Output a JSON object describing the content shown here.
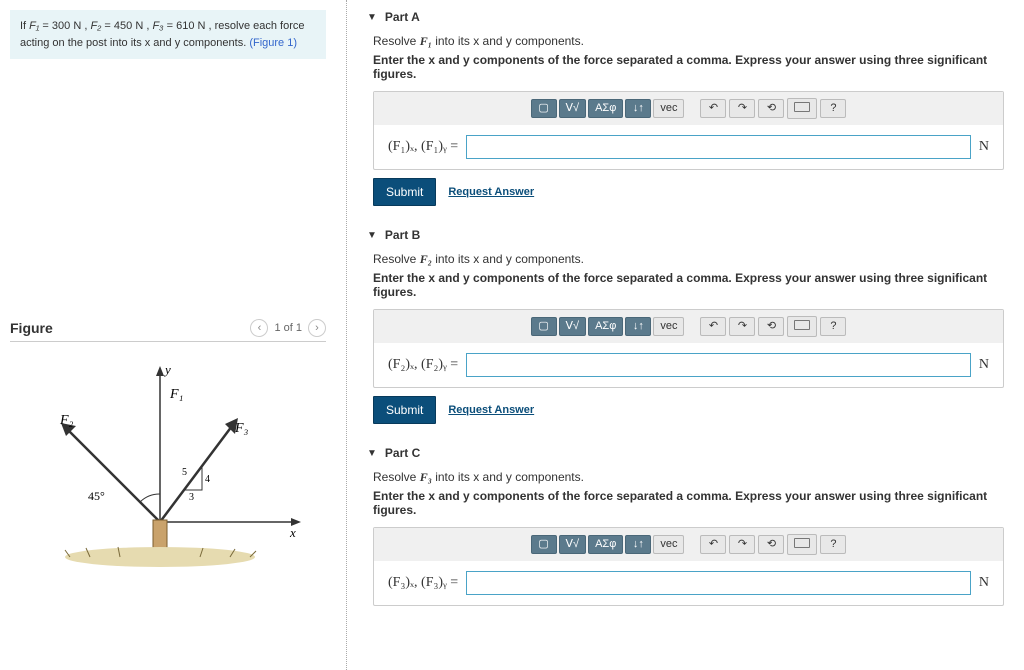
{
  "problem": {
    "prefix": "If ",
    "f1_sym": "F₁",
    "f1_val": " = 300 N ",
    "sep1": ", ",
    "f2_sym": "F₂",
    "f2_val": " = 450 N ",
    "sep2": ", ",
    "f3_sym": "F₃",
    "f3_val": " = 610 N ",
    "suffix": ", resolve each force acting on the post into its x and y components. ",
    "figref": "(Figure 1)"
  },
  "figure": {
    "title": "Figure",
    "counter": "1 of 1",
    "labels": {
      "y": "y",
      "x": "x",
      "f1": "F₁",
      "f2": "F₂",
      "f3": "F₃",
      "angle": "45°",
      "rise": "5",
      "run1": "4",
      "run2": "3"
    }
  },
  "parts": [
    {
      "title": "Part A",
      "resolve_pre": "Resolve ",
      "resolve_sym": "F₁",
      "resolve_post": " into its x and y components.",
      "enter": "Enter the x and y components of the force separated a comma. Express your answer using three significant figures.",
      "var_label": "(F₁)ₓ, (F₁)ᵧ =",
      "unit": "N"
    },
    {
      "title": "Part B",
      "resolve_pre": "Resolve ",
      "resolve_sym": "F₂",
      "resolve_post": " into its x and y components.",
      "enter": "Enter the x and y components of the force separated a comma. Express your answer using three significant figures.",
      "var_label": "(F₂)ₓ, (F₂)ᵧ =",
      "unit": "N"
    },
    {
      "title": "Part C",
      "resolve_pre": "Resolve ",
      "resolve_sym": "F₃",
      "resolve_post": " into its x and y components.",
      "enter": "Enter the x and y components of the force separated a comma. Express your answer using three significant figures.",
      "var_label": "(F₃)ₓ, (F₃)ᵧ =",
      "unit": "N"
    }
  ],
  "toolbar": {
    "templates": "▢",
    "sqrt": "ᐯ√",
    "greek": "ΑΣφ",
    "subsup": "↓↑",
    "vec": "vec",
    "undo": "↶",
    "redo": "↷",
    "reset": "⟲",
    "keyboard": "⌨",
    "help": "?"
  },
  "actions": {
    "submit": "Submit",
    "request": "Request Answer"
  }
}
